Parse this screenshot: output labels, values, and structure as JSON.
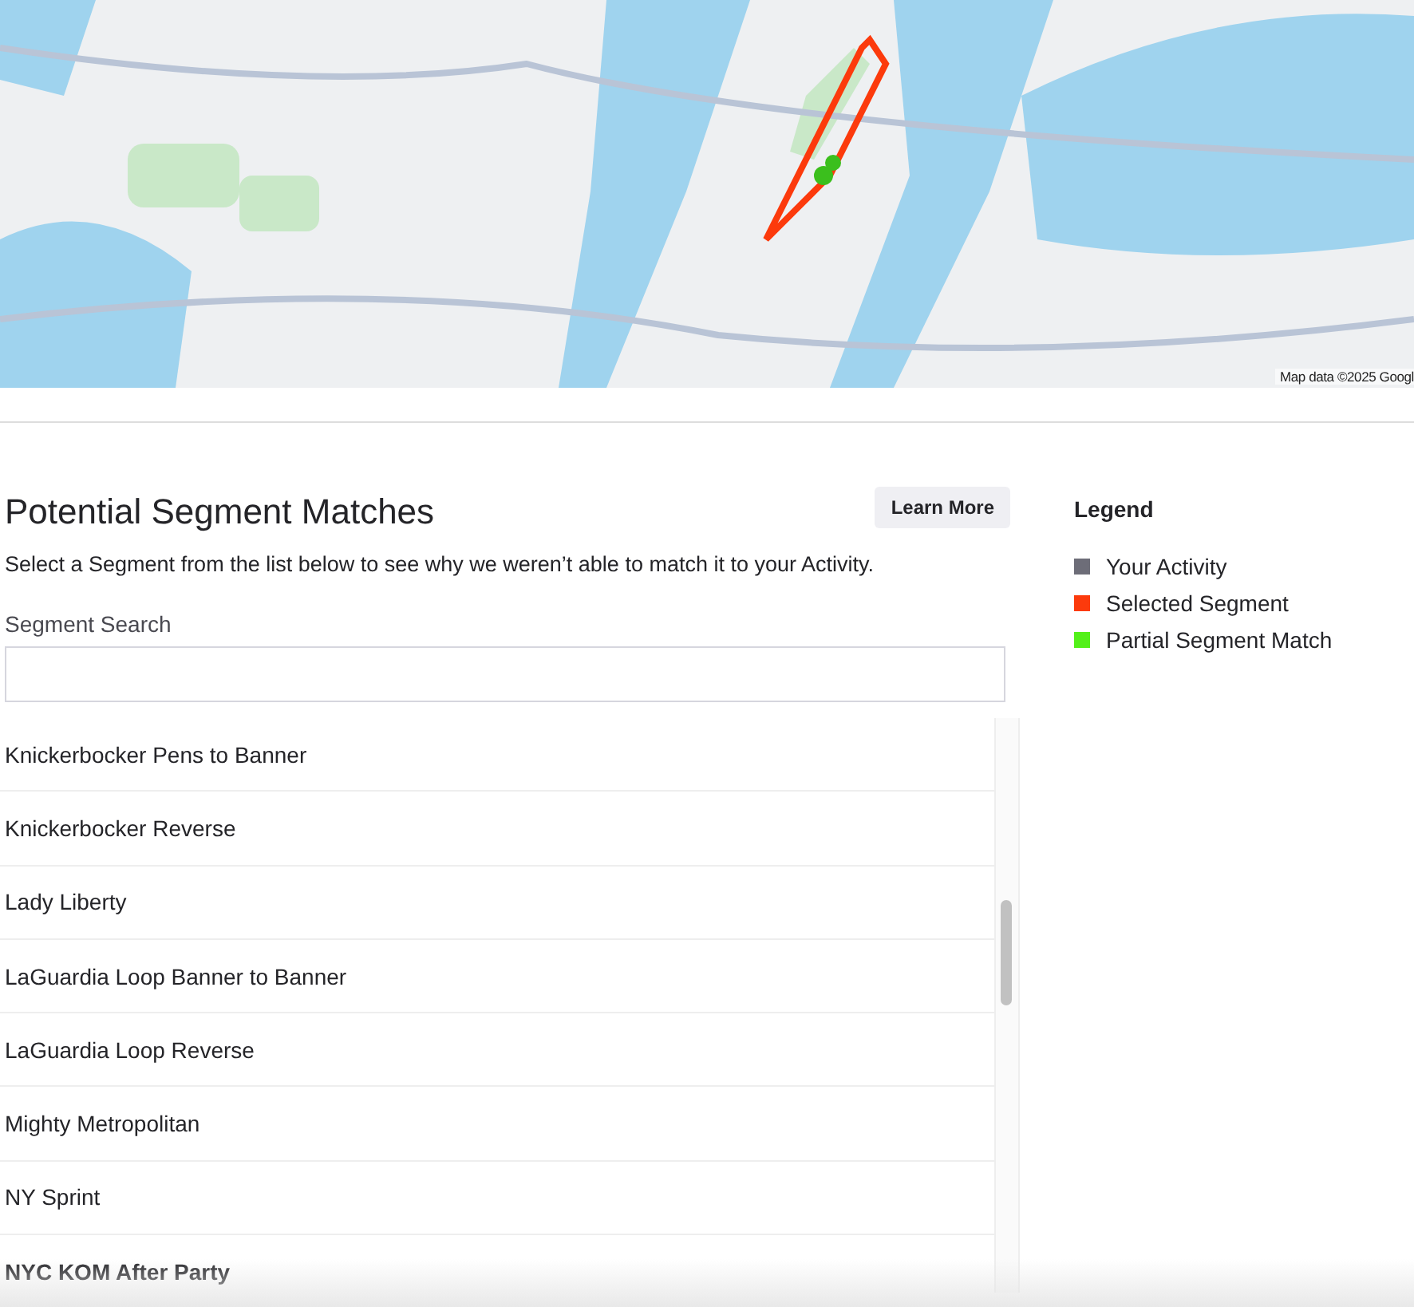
{
  "map": {
    "kind": "picture",
    "attribution": "Map data ©2025 Googl"
  },
  "heading": "Potential Segment Matches",
  "learn_more": "Learn More",
  "description": "Select a Segment from the list below to see why we weren’t able to match it to your Activity.",
  "search": {
    "label": "Segment Search"
  },
  "segments": [
    {
      "name": "Knickerbocker Pens to Banner",
      "selected": false
    },
    {
      "name": "Knickerbocker Reverse",
      "selected": false
    },
    {
      "name": "Lady Liberty",
      "selected": false
    },
    {
      "name": "LaGuardia Loop Banner to Banner",
      "selected": false
    },
    {
      "name": "LaGuardia Loop Reverse",
      "selected": false
    },
    {
      "name": "Mighty Metropolitan",
      "selected": false
    },
    {
      "name": "NY Sprint",
      "selected": false
    },
    {
      "name": "NYC KOM After Party",
      "selected": true
    }
  ],
  "legend": {
    "title": "Legend",
    "items": [
      {
        "label": "Your Activity",
        "color": "#6d6d78"
      },
      {
        "label": "Selected Segment",
        "color": "#fc3a0c"
      },
      {
        "label": "Partial Segment Match",
        "color": "#53f01a"
      }
    ]
  }
}
